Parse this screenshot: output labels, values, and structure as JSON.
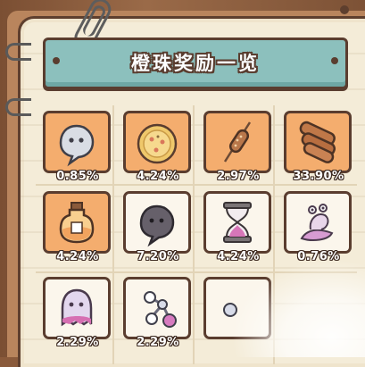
{
  "banner": {
    "title": "橙珠奖励一览"
  },
  "rows": [
    [
      {
        "icon": "ghost-icon",
        "percent": "0.85%",
        "rare": true
      },
      {
        "icon": "pizza-coin-icon",
        "percent": "4.24%",
        "rare": true
      },
      {
        "icon": "skewer-icon",
        "percent": "2.97%",
        "rare": true
      },
      {
        "icon": "bread-rolls-icon",
        "percent": "33.90%",
        "rare": true
      }
    ],
    [
      {
        "icon": "potion-bottle-icon",
        "percent": "4.24%",
        "rare": true
      },
      {
        "icon": "dark-ghost-icon",
        "percent": "7.20%",
        "rare": false
      },
      {
        "icon": "hourglass-icon",
        "percent": "4.24%",
        "rare": false
      },
      {
        "icon": "snail-icon",
        "percent": "0.76%",
        "rare": false
      }
    ],
    [
      {
        "icon": "pink-ghost-icon",
        "percent": "2.29%",
        "rare": false
      },
      {
        "icon": "molecule-icon",
        "percent": "2.29%",
        "rare": false
      },
      {
        "icon": "partial-item-icon",
        "percent": "",
        "rare": false
      }
    ]
  ],
  "colors": {
    "card_orange": "#f4ad6e",
    "card_light": "#fbf6ec",
    "banner": "#8cc0bd",
    "border": "#5a3d2f",
    "paper": "#f4ecd8"
  }
}
